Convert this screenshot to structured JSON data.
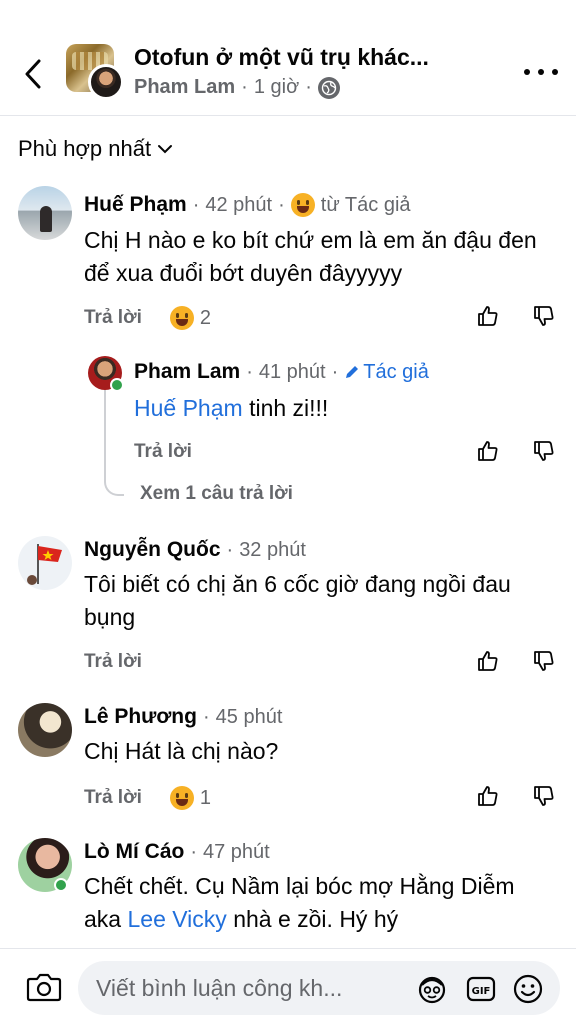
{
  "header": {
    "title": "Otofun ở một vũ trụ khác...",
    "author": "Pham Lam",
    "time": "1 giờ"
  },
  "sort": {
    "label": "Phù hợp nhất"
  },
  "comments": [
    {
      "name": "Huế Phạm",
      "time": "42 phút",
      "badge": "từ Tác giả",
      "text": "Chị H nào e ko bít chứ em là em ăn đậu đen để xua đuổi bớt duyên đâyyyyy",
      "reply_label": "Trả lời",
      "reaction_count": "2"
    },
    {
      "name": "Pham Lam",
      "time": "41 phút",
      "badge": "Tác giả",
      "mention": "Huế Phạm",
      "text": "tinh zi!!!",
      "reply_label": "Trả lời",
      "see_replies": "Xem 1 câu trả lời"
    },
    {
      "name": "Nguyễn Quốc",
      "time": "32 phút",
      "text": "Tôi biết có chị ăn 6 cốc giờ đang ngồi đau bụng",
      "reply_label": "Trả lời"
    },
    {
      "name": "Lê Phương",
      "time": "45 phút",
      "text": "Chị Hát là chị nào?",
      "reply_label": "Trả lời",
      "reaction_count": "1"
    },
    {
      "name": "Lò Mí Cáo",
      "time": "47 phút",
      "text_before": "Chết chết. Cụ Nầm lại bóc mợ Hằng Diễm aka",
      "mention": "Lee Vicky",
      "text_after": "nhà e zồi. Hý hý"
    }
  ],
  "composer": {
    "placeholder": "Viết bình luận công kh..."
  },
  "colors": {
    "accent": "#216fdb",
    "secondary_text": "#65676b",
    "online": "#31a24c",
    "reaction": "#f7b125"
  }
}
